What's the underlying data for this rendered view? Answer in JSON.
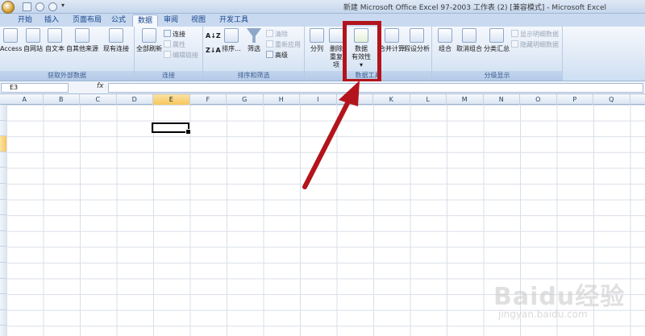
{
  "window": {
    "title": "新建 Microsoft Office Excel 97-2003 工作表 (2) [兼容模式] - Microsoft Excel"
  },
  "tabs": [
    {
      "label": "开始"
    },
    {
      "label": "插入"
    },
    {
      "label": "页面布局"
    },
    {
      "label": "公式"
    },
    {
      "label": "数据",
      "active": true
    },
    {
      "label": "审阅"
    },
    {
      "label": "视图"
    },
    {
      "label": "开发工具"
    }
  ],
  "ribbon": {
    "external": {
      "label": "获取外部数据",
      "access": "Access",
      "web": "自网站",
      "text": "自文本",
      "other": "自其他来源",
      "existing": "现有连接"
    },
    "connections": {
      "label": "连接",
      "refresh_all": "全部刷新",
      "connections": "连接",
      "properties": "属性",
      "edit_links": "编辑链接"
    },
    "sort_filter": {
      "label": "排序和筛选",
      "sort": "排序...",
      "filter": "筛选",
      "clear": "清除",
      "reapply": "重新应用",
      "advanced": "高级"
    },
    "data_tools": {
      "label": "数据工具",
      "text_to_columns": "分列",
      "remove_dup_1": "删除",
      "remove_dup_2": "重复项",
      "validation_1": "数据",
      "validation_2": "有效性",
      "consolidate": "合并计算",
      "what_if": "假设分析"
    },
    "outline": {
      "label": "分级显示",
      "group": "组合",
      "ungroup": "取消组合",
      "subtotal": "分类汇总",
      "show_detail": "显示明细数据",
      "hide_detail": "隐藏明细数据"
    }
  },
  "formula_bar": {
    "name_box": "E3",
    "fx": "fx",
    "value": ""
  },
  "grid": {
    "columns": [
      "A",
      "B",
      "C",
      "D",
      "E",
      "F",
      "G",
      "H",
      "I",
      "J",
      "K",
      "L",
      "M",
      "N",
      "O",
      "P",
      "Q"
    ],
    "selected_column": "E",
    "selected_row": 3
  },
  "watermark": {
    "logo": "Baidu经验",
    "url": "jingyan.baidu.com"
  },
  "colors": {
    "highlight": "#b3141c",
    "ribbon_text": "#15428b",
    "selection": "#f6c65e"
  }
}
